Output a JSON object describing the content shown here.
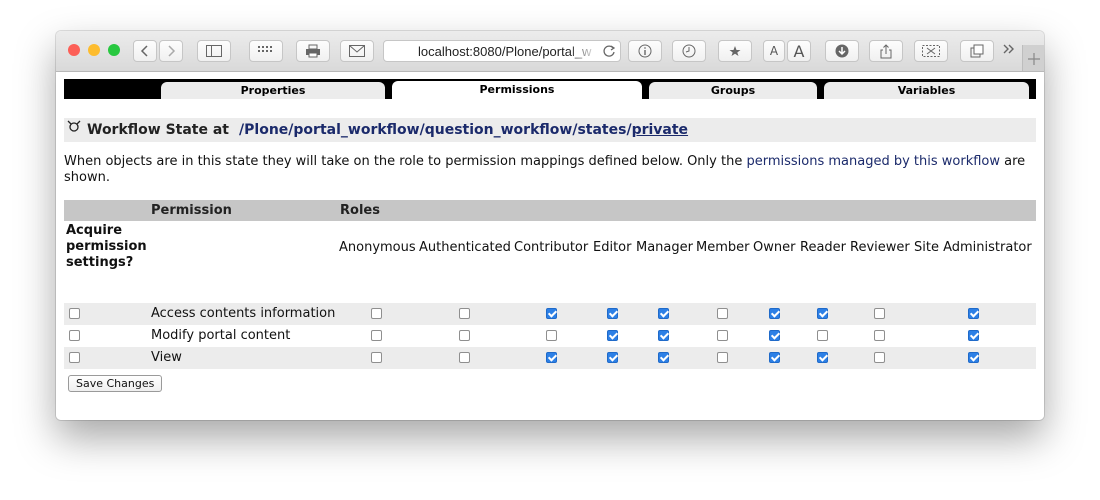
{
  "browser": {
    "url": "localhost:8080/Plone/portal_w",
    "font_small": "A",
    "font_large": "A"
  },
  "tabs": [
    {
      "label": "Properties"
    },
    {
      "label": "Permissions"
    },
    {
      "label": "Groups"
    },
    {
      "label": "Variables"
    }
  ],
  "title": {
    "prefix": "Workflow State at",
    "sep": "/",
    "path": [
      "Plone",
      "portal_workflow",
      "question_workflow",
      "states",
      "private"
    ]
  },
  "intro": {
    "text_before": "When objects are in this state they will take on the role to permission mappings defined below. Only the ",
    "link": "permissions managed by this workflow",
    "text_after": " are shown."
  },
  "table": {
    "header_permission": "Permission",
    "header_roles": "Roles",
    "acquire_label": "Acquire permission settings?",
    "roles": [
      "Anonymous",
      "Authenticated",
      "Contributor",
      "Editor",
      "Manager",
      "Member",
      "Owner",
      "Reader",
      "Reviewer",
      "Site Administrator"
    ],
    "rows": [
      {
        "name": "Access contents information",
        "acquire": false,
        "checks": [
          false,
          false,
          true,
          true,
          true,
          false,
          true,
          true,
          false,
          true
        ]
      },
      {
        "name": "Modify portal content",
        "acquire": false,
        "checks": [
          false,
          false,
          false,
          true,
          true,
          false,
          true,
          false,
          false,
          true
        ]
      },
      {
        "name": "View",
        "acquire": false,
        "checks": [
          false,
          false,
          true,
          true,
          true,
          false,
          true,
          true,
          false,
          true
        ]
      }
    ]
  },
  "save_label": "Save Changes"
}
